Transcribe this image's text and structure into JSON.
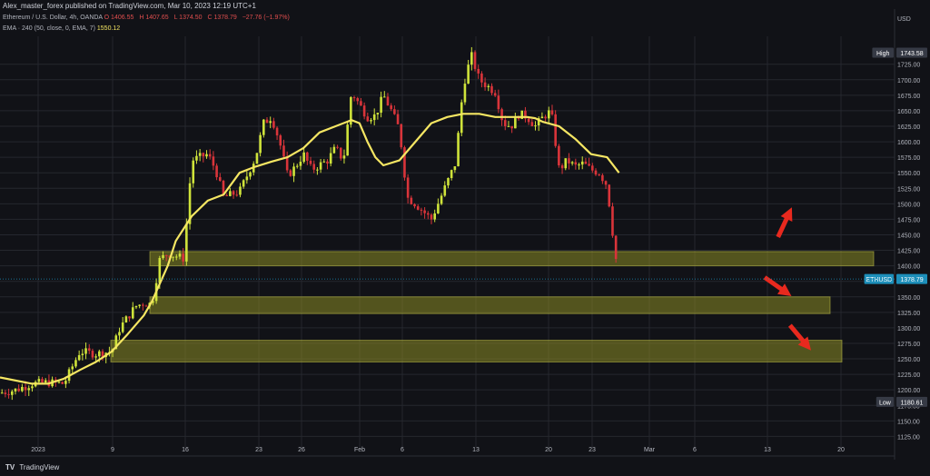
{
  "header": {
    "published": "Alex_master_forex published on TradingView.com, Mar 10, 2023 12:19 UTC+1",
    "ohlc_prefix": "Ethereum / U.S. Dollar, 4h, OANDA",
    "ohlc_values": [
      "O 1406.55",
      "H 1407.65",
      "L 1374.50",
      "C 1378.79",
      "−27.76 (−1.97%)"
    ],
    "ema_label": "EMA · 240 (50, close, 0, EMA, 7)",
    "ema_value": "1550.12"
  },
  "footer": {
    "logo": "TV",
    "brand": "TradingView"
  },
  "chart_data": {
    "type": "line",
    "symbol": "ETHUSD",
    "currency": "USD",
    "y_ticks": [
      1125,
      1150,
      1175,
      1200,
      1225,
      1250,
      1275,
      1300,
      1325,
      1350,
      1375,
      1400,
      1425,
      1450,
      1475,
      1500,
      1525,
      1550,
      1575,
      1600,
      1625,
      1650,
      1675,
      1700,
      1725
    ],
    "ylim": [
      1108,
      1770
    ],
    "x_ticks": [
      "2023",
      "9",
      "16",
      "23",
      "26",
      "Feb",
      "6",
      "13",
      "20",
      "23",
      "Mar",
      "6",
      "13",
      "20"
    ],
    "price_labels": {
      "high_label": "High",
      "high_value": "1743.58",
      "last_label": "ETHUSD",
      "last_value": "1378.79",
      "low_label": "Low",
      "low_value": "1180.61"
    },
    "price_series": {
      "name": "ETHUSD",
      "x": [
        0,
        2,
        4,
        6,
        8,
        10,
        12,
        14,
        15,
        17,
        18,
        19,
        20,
        21,
        23,
        24,
        25,
        26,
        27,
        28,
        30,
        32,
        33,
        34,
        35,
        36,
        37,
        38,
        39,
        41,
        42,
        43,
        44,
        45,
        46,
        47,
        48,
        49,
        50,
        51,
        52,
        54,
        56,
        57,
        58,
        59,
        60,
        61,
        62,
        63,
        64,
        65,
        66,
        67,
        68,
        69,
        70,
        71,
        72,
        73,
        74,
        75,
        76,
        77,
        77.5
      ],
      "values": [
        1195,
        1200,
        1210,
        1212,
        1210,
        1262,
        1258,
        1262,
        1300,
        1335,
        1340,
        1338,
        1410,
        1420,
        1412,
        1570,
        1575,
        1580,
        1555,
        1510,
        1520,
        1575,
        1630,
        1640,
        1600,
        1545,
        1560,
        1580,
        1555,
        1570,
        1590,
        1570,
        1680,
        1660,
        1640,
        1642,
        1675,
        1650,
        1620,
        1510,
        1500,
        1475,
        1535,
        1565,
        1690,
        1740,
        1700,
        1690,
        1680,
        1630,
        1625,
        1645,
        1640,
        1625,
        1640,
        1650,
        1555,
        1570,
        1560,
        1565,
        1555,
        1550,
        1530,
        1420,
        1378.79
      ]
    },
    "ema_series": {
      "name": "EMA · 240 (50, close, 0, EMA, 7)",
      "x": [
        0,
        4,
        6,
        8,
        10,
        12,
        14,
        16,
        18,
        19,
        21,
        22,
        24,
        26,
        28,
        30,
        32,
        34,
        36,
        38,
        40,
        42,
        44,
        45,
        46,
        47,
        48,
        50,
        52,
        54,
        56,
        58,
        60,
        62,
        64,
        66,
        67,
        68,
        70,
        72,
        74,
        76,
        77.5
      ],
      "values": [
        1220,
        1210,
        1210,
        1218,
        1232,
        1245,
        1262,
        1290,
        1320,
        1342,
        1400,
        1440,
        1480,
        1505,
        1515,
        1550,
        1560,
        1568,
        1575,
        1590,
        1615,
        1625,
        1635,
        1630,
        1600,
        1575,
        1562,
        1570,
        1600,
        1630,
        1640,
        1645,
        1645,
        1640,
        1640,
        1640,
        1638,
        1632,
        1625,
        1605,
        1580,
        1575,
        1550
      ]
    },
    "support_zones": [
      [
        1400,
        1423
      ],
      [
        1323,
        1350
      ],
      [
        1245,
        1280
      ]
    ],
    "arrows": [
      "up",
      "down",
      "down"
    ],
    "colors": {
      "bull": "#cfe33a",
      "bear": "#d9343a",
      "ema": "#f5e663",
      "zone": "#8a8a24",
      "arrow": "#e8291e",
      "grid": "#25272e",
      "axis_text": "#b2b5be",
      "high_low_bg": "#363a45",
      "last_bg": "#1d8fba"
    },
    "grid": true
  }
}
